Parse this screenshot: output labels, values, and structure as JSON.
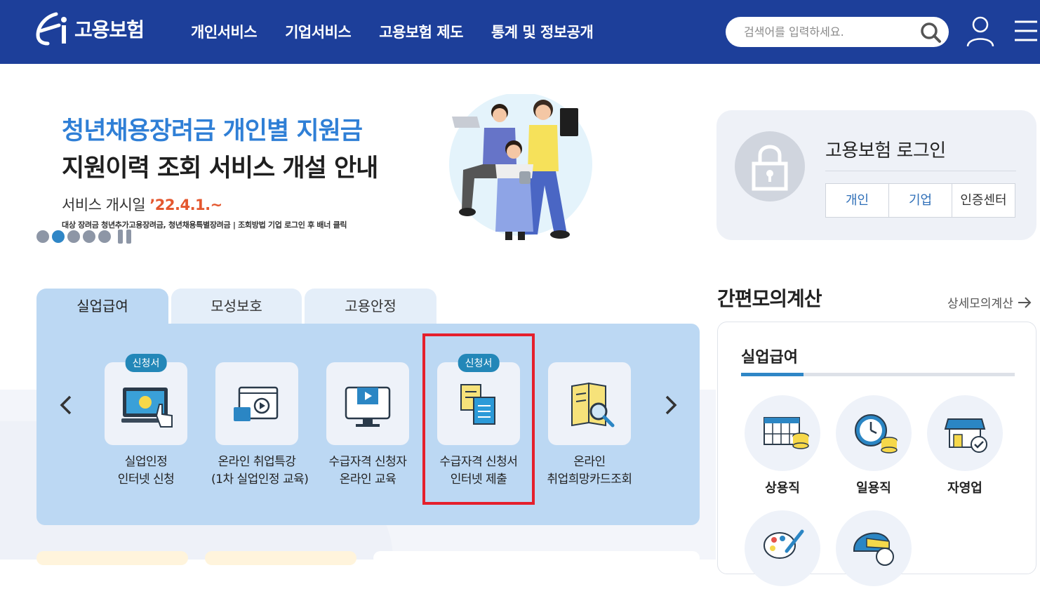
{
  "header": {
    "logo_text": "고용보험",
    "nav": [
      "개인서비스",
      "기업서비스",
      "고용보험 제도",
      "통계 및 정보공개"
    ],
    "search_placeholder": "검색어를 입력하세요."
  },
  "banner": {
    "line1": "청년채용장려금 개인별 지원금",
    "line2": "지원이력 조회 서비스 개설 안내",
    "date_label": "서비스 개시일 ",
    "date_value": "’22.4.1.~",
    "note": "대상 장려금 청년추가고용장려금, 청년채용특별장려금 | 조회방법 기업 로그인 후 배너 클릭",
    "slide_count": 5,
    "active_slide": 2
  },
  "login": {
    "title": "고용보험 로그인",
    "buttons": [
      "개인",
      "기업",
      "인증센터"
    ]
  },
  "tabs": [
    "실업급여",
    "모성보호",
    "고용안정"
  ],
  "services": [
    {
      "badge": "신청서",
      "line1": "실업인정",
      "line2": "인터넷 신청"
    },
    {
      "badge": "",
      "line1": "온라인 취업특강",
      "line2": "(1차 실업인정 교육)"
    },
    {
      "badge": "",
      "line1": "수급자격 신청자",
      "line2": "온라인 교육"
    },
    {
      "badge": "신청서",
      "line1": "수급자격 신청서",
      "line2": "인터넷 제출"
    },
    {
      "badge": "",
      "line1": "온라인",
      "line2": "취업희망카드조회"
    }
  ],
  "calculator": {
    "title": "간편모의계산",
    "more": "상세모의계산",
    "subtitle": "실업급여",
    "items": [
      "상용직",
      "일용직",
      "자영업"
    ]
  },
  "colors": {
    "header_bg": "#1d3f9a",
    "accent_blue": "#2f86c6",
    "highlight_red": "#e51f2c",
    "tab_panel": "#bcd8f3"
  }
}
